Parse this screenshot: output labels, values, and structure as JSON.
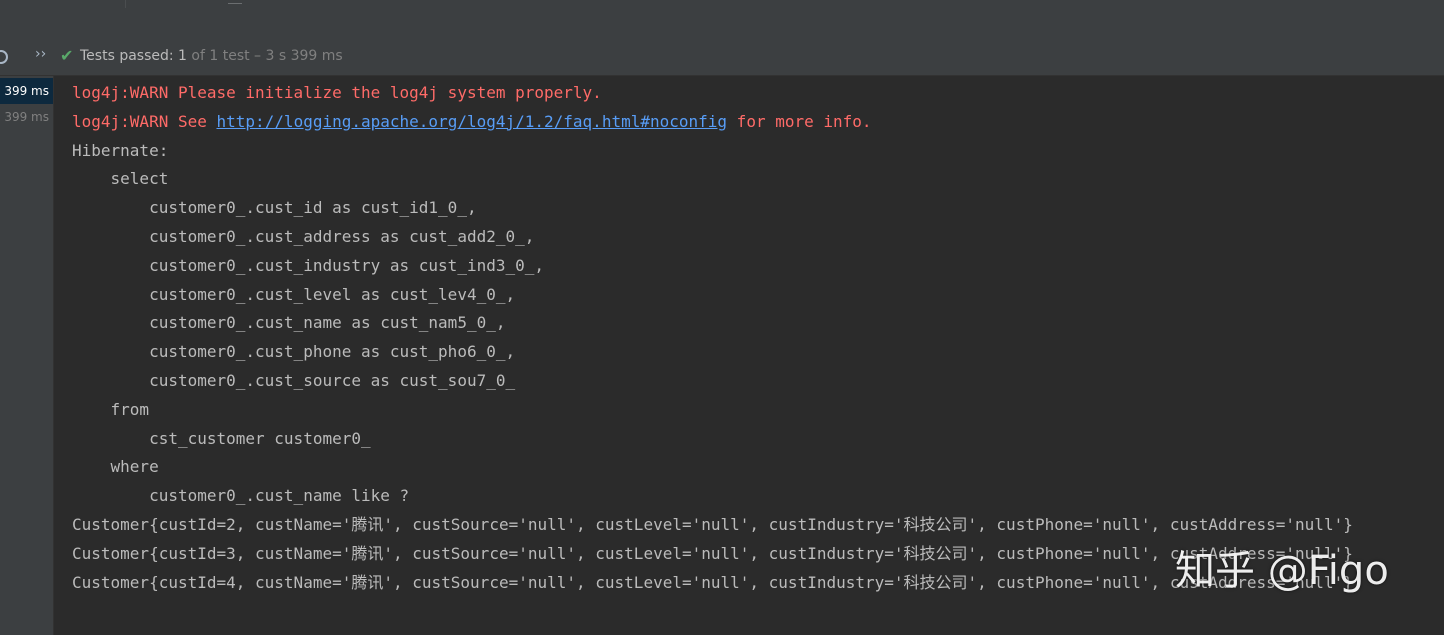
{
  "status": {
    "label": "Tests passed:",
    "count": "1",
    "detail": "of 1 test – 3 s 399 ms",
    "expand_glyph": "››",
    "check_glyph": "✔"
  },
  "test_tree": [
    {
      "duration": "399 ms"
    },
    {
      "duration": "399 ms"
    }
  ],
  "console": {
    "warn1": "log4j:WARN Please initialize the log4j system properly.",
    "warn2_prefix": "log4j:WARN See ",
    "warn2_link": "http://logging.apache.org/log4j/1.2/faq.html#noconfig",
    "warn2_suffix": " for more info.",
    "lines": [
      "Hibernate: ",
      "    select",
      "        customer0_.cust_id as cust_id1_0_,",
      "        customer0_.cust_address as cust_add2_0_,",
      "        customer0_.cust_industry as cust_ind3_0_,",
      "        customer0_.cust_level as cust_lev4_0_,",
      "        customer0_.cust_name as cust_nam5_0_,",
      "        customer0_.cust_phone as cust_pho6_0_,",
      "        customer0_.cust_source as cust_sou7_0_ ",
      "    from",
      "        cst_customer customer0_ ",
      "    where",
      "        customer0_.cust_name like ?",
      "Customer{custId=2, custName='腾讯', custSource='null', custLevel='null', custIndustry='科技公司', custPhone='null', custAddress='null'}",
      "Customer{custId=3, custName='腾讯', custSource='null', custLevel='null', custIndustry='科技公司', custPhone='null', custAddress='null'}",
      "Customer{custId=4, custName='腾讯', custSource='null', custLevel='null', custIndustry='科技公司', custPhone='null', custAddress='null'}"
    ]
  },
  "watermark": "知乎 @Figo",
  "colors": {
    "background": "#2b2b2b",
    "panel": "#3c3f41",
    "text": "#bbbbbb",
    "warn": "#ff6b68",
    "link": "#589df6",
    "success": "#59a869",
    "selection": "#0d293e"
  },
  "icons": {
    "rerun": "rerun-icon",
    "expand": "double-chevron-icon",
    "passed": "checkmark-icon"
  }
}
